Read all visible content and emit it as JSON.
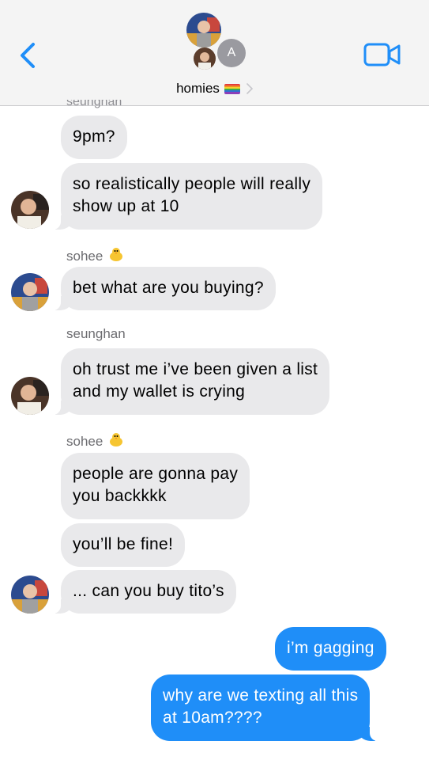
{
  "header": {
    "group_name": "homies",
    "group_member_initial": "A",
    "back_icon": "chevron-left-icon",
    "video_icon": "video-camera-icon",
    "accent": "#1f8ef8"
  },
  "conversation": {
    "cut_sender": "seunghan",
    "messages": [
      {
        "text": "9pm?"
      },
      {
        "line1": "so realistically people will really",
        "line2": "show up at 10"
      },
      {
        "sender": "sohee",
        "text": "bet what are you buying?"
      },
      {
        "sender": "seunghan",
        "line1": "oh trust me i’ve been given a list",
        "line2": "and my wallet is crying"
      },
      {
        "sender": "sohee",
        "line1": "people are gonna pay",
        "line2": "you backkkk"
      },
      {
        "text": "you’ll be fine!"
      },
      {
        "text": "... can you buy tito’s"
      },
      {
        "text": "i’m gagging"
      },
      {
        "line1": "why are we texting all this",
        "line2": "at 10am????"
      }
    ]
  },
  "colors": {
    "incoming_bubble": "#e9e9eb",
    "outgoing_bubble": "#1f8ef8",
    "sender_label": "#6c6c70"
  }
}
